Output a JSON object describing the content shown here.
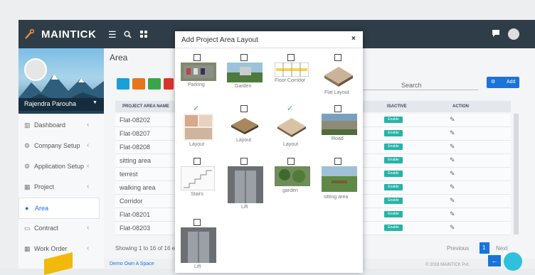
{
  "app": {
    "brand": "MAINTICK"
  },
  "sidebar": {
    "user": "Rajendra Parouha",
    "items": [
      {
        "label": "Dashboard",
        "icon": "chart-icon"
      },
      {
        "label": "Company Setup",
        "icon": "gear-icon"
      },
      {
        "label": "Application Setup",
        "icon": "gears-icon"
      },
      {
        "label": "Project",
        "icon": "building-icon"
      },
      {
        "label": "Area",
        "icon": "pin-icon"
      },
      {
        "label": "Contract",
        "icon": "contract-icon"
      },
      {
        "label": "Work Order",
        "icon": "grid-icon"
      }
    ]
  },
  "main": {
    "title": "Area",
    "search_label": "Search",
    "add_label": "Add",
    "columns": [
      "PROJECT AREA NAME",
      "ISACTIVE",
      "ACTION"
    ],
    "rows": [
      "Flat-08202",
      "Flat-08207",
      "Flat-08208",
      "sitting area",
      "terrest",
      "walking area",
      "Corridor",
      "Flat-08201",
      "Flat-08203"
    ],
    "enable_label": "Enable",
    "showing": "Showing 1 to 16 of 16 en",
    "prev": "Previous",
    "page": "1",
    "next": "Next",
    "footer_link": "Demo Own A Space",
    "copyright": "© 2018 MAINTICK Pvt."
  },
  "modal": {
    "title": "Add Project Area Layout",
    "close": "×",
    "items": [
      {
        "label": "Parking",
        "checked": false
      },
      {
        "label": "Garden",
        "checked": false
      },
      {
        "label": "Floor Corridor",
        "checked": false
      },
      {
        "label": "Flat Layout",
        "checked": false
      },
      {
        "label": "Layout",
        "checked": true
      },
      {
        "label": "Layout",
        "checked": false
      },
      {
        "label": "Layout",
        "checked": true
      },
      {
        "label": "Road",
        "checked": false
      },
      {
        "label": "Stairs",
        "checked": false
      },
      {
        "label": "Lift",
        "checked": false
      },
      {
        "label": "garden",
        "checked": false
      },
      {
        "label": "sitting area",
        "checked": false
      },
      {
        "label": "Lift",
        "checked": false
      }
    ]
  },
  "colors": {
    "topbar": "#2e3d47",
    "accent": "#1a73d9",
    "enable": "#26b3a8"
  }
}
